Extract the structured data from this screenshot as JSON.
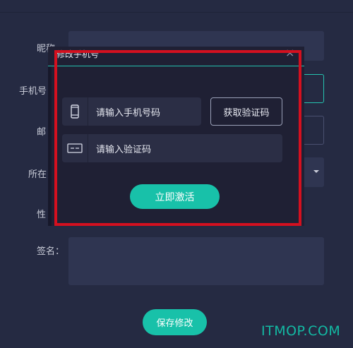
{
  "form": {
    "nickname_label": "昵称",
    "phone_label": "手机号",
    "email_label": "邮",
    "location_label": "所在",
    "gender_label": "性",
    "signature_label": "签名：",
    "save_button": "保存修改"
  },
  "modal": {
    "title": "修改手机号",
    "close": "×",
    "phone_placeholder": "请输入手机号码",
    "get_code_button": "获取验证码",
    "code_placeholder": "请输入验证码",
    "activate_button": "立即激活"
  },
  "watermark": "ITMOP.COM",
  "colors": {
    "accent": "#18c1a9",
    "highlight": "#d4101f",
    "background": "#252a42",
    "modal_background": "#1f2034"
  },
  "icons": [
    "phone-icon",
    "id-card-icon",
    "close-icon",
    "chevron-down-icon"
  ]
}
